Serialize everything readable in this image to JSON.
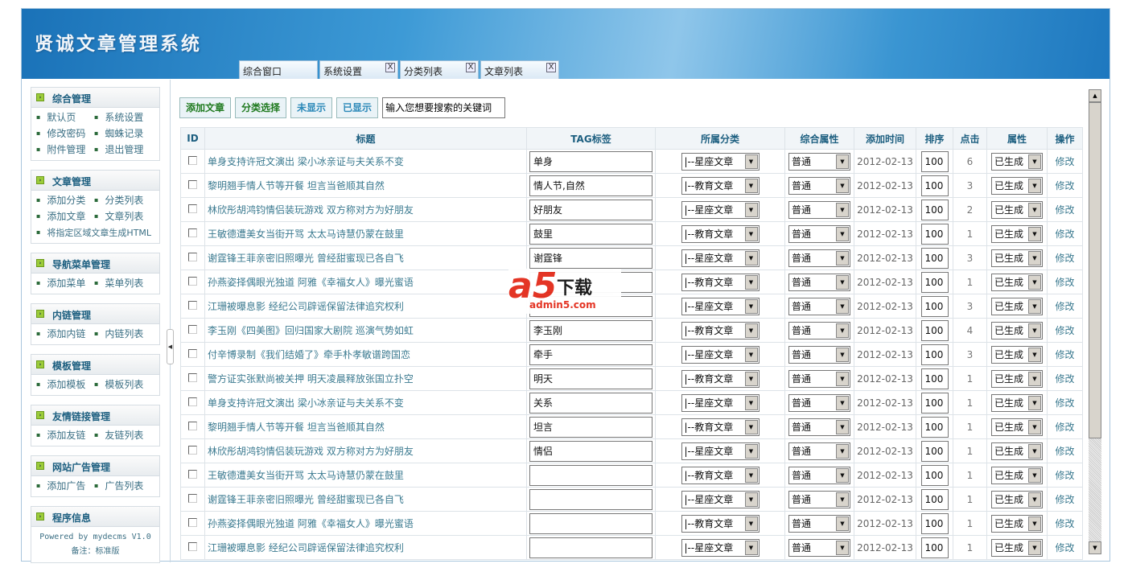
{
  "app": {
    "title": "贤诚文章管理系统"
  },
  "tabs": [
    {
      "label": "综合窗口",
      "closable": false
    },
    {
      "label": "系统设置",
      "closable": true
    },
    {
      "label": "分类列表",
      "closable": true
    },
    {
      "label": "文章列表",
      "closable": true
    }
  ],
  "close_glyph": "X",
  "sidebar": [
    {
      "title": "综合管理",
      "links": [
        "默认页",
        "系统设置",
        "修改密码",
        "蜘蛛记录",
        "附件管理",
        "退出管理"
      ]
    },
    {
      "title": "文章管理",
      "links": [
        "添加分类",
        "分类列表",
        "添加文章",
        "文章列表",
        "将指定区域文章生成HTML"
      ]
    },
    {
      "title": "导航菜单管理",
      "links": [
        "添加菜单",
        "菜单列表"
      ]
    },
    {
      "title": "内链管理",
      "links": [
        "添加内链",
        "内链列表"
      ]
    },
    {
      "title": "模板管理",
      "links": [
        "添加模板",
        "模板列表"
      ]
    },
    {
      "title": "友情链接管理",
      "links": [
        "添加友链",
        "友链列表"
      ]
    },
    {
      "title": "网站广告管理",
      "links": [
        "添加广告",
        "广告列表"
      ]
    }
  ],
  "program_info": {
    "title": "程序信息",
    "powered": "Powered by mydecms V1.0",
    "note": "备注：标准版"
  },
  "toolbar": {
    "add": "添加文章",
    "category": "分类选择",
    "hidden": "未显示",
    "shown": "已显示",
    "search_value": "输入您想要搜索的关键词"
  },
  "table": {
    "headers": [
      "ID",
      "标题",
      "TAG标签",
      "所属分类",
      "综合属性",
      "添加时间",
      "排序",
      "点击",
      "属性",
      "操作"
    ],
    "rows": [
      {
        "title": "单身支持许冠文演出 梁小冰亲证与夫关系不变",
        "tag": "单身",
        "category": "|--星座文章",
        "attr": "普通",
        "date": "2012-02-13",
        "order": "100",
        "clicks": "6",
        "status": "已生成",
        "op": "修改"
      },
      {
        "title": "黎明翘手情人节等开餐 坦言当爸顺其自然",
        "tag": "情人节,自然",
        "category": "|--教育文章",
        "attr": "普通",
        "date": "2012-02-13",
        "order": "100",
        "clicks": "3",
        "status": "已生成",
        "op": "修改"
      },
      {
        "title": "林欣彤胡鸿钧情侣装玩游戏 双方称对方为好朋友",
        "tag": "好朋友",
        "category": "|--星座文章",
        "attr": "普通",
        "date": "2012-02-13",
        "order": "100",
        "clicks": "2",
        "status": "已生成",
        "op": "修改"
      },
      {
        "title": "王敏德遭美女当街开骂 太太马诗慧仍蒙在鼓里",
        "tag": "鼓里",
        "category": "|--教育文章",
        "attr": "普通",
        "date": "2012-02-13",
        "order": "100",
        "clicks": "1",
        "status": "已生成",
        "op": "修改"
      },
      {
        "title": "谢霆锋王菲亲密旧照曝光 曾经甜蜜现已各自飞",
        "tag": "谢霆锋",
        "category": "|--星座文章",
        "attr": "普通",
        "date": "2012-02-13",
        "order": "100",
        "clicks": "3",
        "status": "已生成",
        "op": "修改"
      },
      {
        "title": "孙燕姿择偶眼光独道 阿雅《幸福女人》曝光蜜语",
        "tag": "",
        "category": "|--教育文章",
        "attr": "普通",
        "date": "2012-02-13",
        "order": "100",
        "clicks": "1",
        "status": "已生成",
        "op": "修改"
      },
      {
        "title": "江珊被曝息影 经纪公司辟谣保留法律追究权利",
        "tag": "",
        "category": "|--星座文章",
        "attr": "普通",
        "date": "2012-02-13",
        "order": "100",
        "clicks": "3",
        "status": "已生成",
        "op": "修改"
      },
      {
        "title": "李玉刚《四美图》回归国家大剧院 巡演气势如虹",
        "tag": "李玉刚",
        "category": "|--教育文章",
        "attr": "普通",
        "date": "2012-02-13",
        "order": "100",
        "clicks": "4",
        "status": "已生成",
        "op": "修改"
      },
      {
        "title": "付辛博录制《我们结婚了》牵手朴孝敏谱跨国恋",
        "tag": "牵手",
        "category": "|--星座文章",
        "attr": "普通",
        "date": "2012-02-13",
        "order": "100",
        "clicks": "3",
        "status": "已生成",
        "op": "修改"
      },
      {
        "title": "警方证实张默尚被关押 明天凌晨释放张国立扑空",
        "tag": "明天",
        "category": "|--教育文章",
        "attr": "普通",
        "date": "2012-02-13",
        "order": "100",
        "clicks": "1",
        "status": "已生成",
        "op": "修改"
      },
      {
        "title": "单身支持许冠文演出 梁小冰亲证与夫关系不变",
        "tag": "关系",
        "category": "|--星座文章",
        "attr": "普通",
        "date": "2012-02-13",
        "order": "100",
        "clicks": "1",
        "status": "已生成",
        "op": "修改"
      },
      {
        "title": "黎明翘手情人节等开餐 坦言当爸顺其自然",
        "tag": "坦言",
        "category": "|--教育文章",
        "attr": "普通",
        "date": "2012-02-13",
        "order": "100",
        "clicks": "1",
        "status": "已生成",
        "op": "修改"
      },
      {
        "title": "林欣彤胡鸿钧情侣装玩游戏 双方称对方为好朋友",
        "tag": "情侣",
        "category": "|--星座文章",
        "attr": "普通",
        "date": "2012-02-13",
        "order": "100",
        "clicks": "1",
        "status": "已生成",
        "op": "修改"
      },
      {
        "title": "王敏德遭美女当街开骂 太太马诗慧仍蒙在鼓里",
        "tag": "",
        "category": "|--教育文章",
        "attr": "普通",
        "date": "2012-02-13",
        "order": "100",
        "clicks": "1",
        "status": "已生成",
        "op": "修改"
      },
      {
        "title": "谢霆锋王菲亲密旧照曝光 曾经甜蜜现已各自飞",
        "tag": "",
        "category": "|--星座文章",
        "attr": "普通",
        "date": "2012-02-13",
        "order": "100",
        "clicks": "1",
        "status": "已生成",
        "op": "修改"
      },
      {
        "title": "孙燕姿择偶眼光独道 阿雅《幸福女人》曝光蜜语",
        "tag": "",
        "category": "|--教育文章",
        "attr": "普通",
        "date": "2012-02-13",
        "order": "100",
        "clicks": "1",
        "status": "已生成",
        "op": "修改"
      },
      {
        "title": "江珊被曝息影 经纪公司辟谣保留法律追究权利",
        "tag": "",
        "category": "|--星座文章",
        "attr": "普通",
        "date": "2012-02-13",
        "order": "100",
        "clicks": "1",
        "status": "已生成",
        "op": "修改"
      }
    ]
  },
  "watermark": {
    "a": "a5",
    "text": "下载",
    "domain": "admin5.com"
  }
}
